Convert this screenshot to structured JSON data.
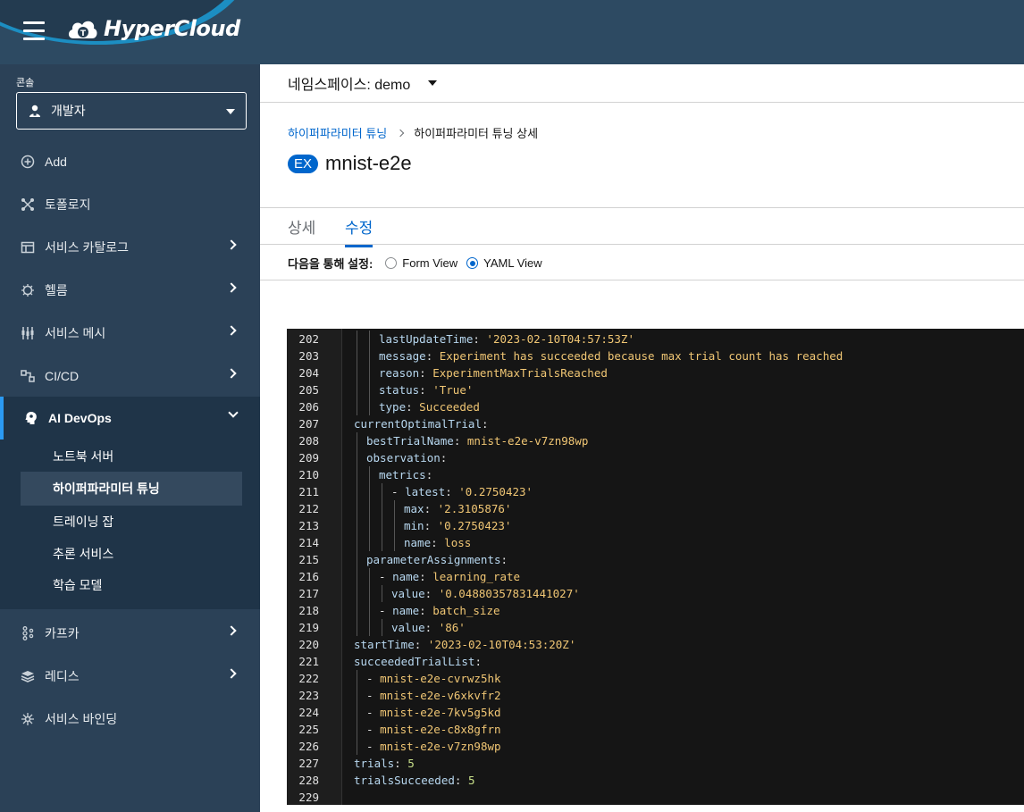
{
  "header": {
    "logo": "HyperCloud"
  },
  "sidebar": {
    "perspective_label": "콘솔",
    "perspective": "개발자",
    "items": [
      {
        "label": "Add",
        "icon": "add-circle-icon",
        "has_children": false
      },
      {
        "label": "토폴로지",
        "icon": "topology-icon",
        "has_children": false
      },
      {
        "label": "서비스 카탈로그",
        "icon": "catalog-icon",
        "has_children": true
      },
      {
        "label": "헬름",
        "icon": "helm-icon",
        "has_children": true
      },
      {
        "label": "서비스 메시",
        "icon": "mesh-icon",
        "has_children": true
      },
      {
        "label": "CI/CD",
        "icon": "cicd-icon",
        "has_children": true
      },
      {
        "label": "AI DevOps",
        "icon": "ai-brain-icon",
        "has_children": true,
        "expanded": true
      },
      {
        "label": "카프카",
        "icon": "kafka-icon",
        "has_children": true
      },
      {
        "label": "레디스",
        "icon": "redis-icon",
        "has_children": true
      },
      {
        "label": "서비스 바인딩",
        "icon": "binding-icon",
        "has_children": false
      }
    ],
    "sub_items": [
      {
        "label": "노트북 서버"
      },
      {
        "label": "하이퍼파라미터 튜닝",
        "selected": true
      },
      {
        "label": "트레이닝 잡"
      },
      {
        "label": "추론 서비스"
      },
      {
        "label": "학습 모델"
      }
    ]
  },
  "namespace": {
    "label": "네임스페이스: demo"
  },
  "breadcrumb": {
    "parent": "하이퍼파라미터 튜닝",
    "current": "하이퍼파라미터 튜닝 상세"
  },
  "page": {
    "badge": "EX",
    "title": "mnist-e2e"
  },
  "tabs": [
    {
      "label": "상세"
    },
    {
      "label": "수정",
      "active": true
    }
  ],
  "config": {
    "label": "다음을 통해 설정:",
    "options": [
      {
        "label": "Form View",
        "checked": false
      },
      {
        "label": "YAML View",
        "checked": true
      }
    ]
  },
  "editor": {
    "lines": [
      {
        "n": "202",
        "indent": 3,
        "tokens": [
          [
            "k",
            "lastUpdateTime"
          ],
          [
            "p",
            ": "
          ],
          [
            "s",
            "'2023-02-10T04:57:53Z'"
          ]
        ]
      },
      {
        "n": "203",
        "indent": 3,
        "tokens": [
          [
            "k",
            "message"
          ],
          [
            "p",
            ": "
          ],
          [
            "s",
            "Experiment has succeeded because max trial count has reached"
          ]
        ]
      },
      {
        "n": "204",
        "indent": 3,
        "tokens": [
          [
            "k",
            "reason"
          ],
          [
            "p",
            ": "
          ],
          [
            "s",
            "ExperimentMaxTrialsReached"
          ]
        ]
      },
      {
        "n": "205",
        "indent": 3,
        "tokens": [
          [
            "k",
            "status"
          ],
          [
            "p",
            ": "
          ],
          [
            "s",
            "'True'"
          ]
        ]
      },
      {
        "n": "206",
        "indent": 3,
        "tokens": [
          [
            "k",
            "type"
          ],
          [
            "p",
            ": "
          ],
          [
            "s",
            "Succeeded"
          ]
        ]
      },
      {
        "n": "207",
        "indent": 1,
        "tokens": [
          [
            "k",
            "currentOptimalTrial"
          ],
          [
            "p",
            ":"
          ]
        ]
      },
      {
        "n": "208",
        "indent": 2,
        "tokens": [
          [
            "k",
            "bestTrialName"
          ],
          [
            "p",
            ": "
          ],
          [
            "s",
            "mnist-e2e-v7zn98wp"
          ]
        ]
      },
      {
        "n": "209",
        "indent": 2,
        "tokens": [
          [
            "k",
            "observation"
          ],
          [
            "p",
            ":"
          ]
        ]
      },
      {
        "n": "210",
        "indent": 3,
        "tokens": [
          [
            "k",
            "metrics"
          ],
          [
            "p",
            ":"
          ]
        ]
      },
      {
        "n": "211",
        "indent": 4,
        "tokens": [
          [
            "p",
            "- "
          ],
          [
            "k",
            "latest"
          ],
          [
            "p",
            ": "
          ],
          [
            "s",
            "'0.2750423'"
          ]
        ]
      },
      {
        "n": "212",
        "indent": 5,
        "tokens": [
          [
            "k",
            "max"
          ],
          [
            "p",
            ": "
          ],
          [
            "s",
            "'2.3105876'"
          ]
        ]
      },
      {
        "n": "213",
        "indent": 5,
        "tokens": [
          [
            "k",
            "min"
          ],
          [
            "p",
            ": "
          ],
          [
            "s",
            "'0.2750423'"
          ]
        ]
      },
      {
        "n": "214",
        "indent": 5,
        "tokens": [
          [
            "k",
            "name"
          ],
          [
            "p",
            ": "
          ],
          [
            "s",
            "loss"
          ]
        ]
      },
      {
        "n": "215",
        "indent": 2,
        "tokens": [
          [
            "k",
            "parameterAssignments"
          ],
          [
            "p",
            ":"
          ]
        ]
      },
      {
        "n": "216",
        "indent": 3,
        "tokens": [
          [
            "p",
            "- "
          ],
          [
            "k",
            "name"
          ],
          [
            "p",
            ": "
          ],
          [
            "s",
            "learning_rate"
          ]
        ]
      },
      {
        "n": "217",
        "indent": 4,
        "tokens": [
          [
            "k",
            "value"
          ],
          [
            "p",
            ": "
          ],
          [
            "s",
            "'0.04880357831441027'"
          ]
        ]
      },
      {
        "n": "218",
        "indent": 3,
        "tokens": [
          [
            "p",
            "- "
          ],
          [
            "k",
            "name"
          ],
          [
            "p",
            ": "
          ],
          [
            "s",
            "batch_size"
          ]
        ]
      },
      {
        "n": "219",
        "indent": 4,
        "tokens": [
          [
            "k",
            "value"
          ],
          [
            "p",
            ": "
          ],
          [
            "s",
            "'86'"
          ]
        ]
      },
      {
        "n": "220",
        "indent": 1,
        "tokens": [
          [
            "k",
            "startTime"
          ],
          [
            "p",
            ": "
          ],
          [
            "s",
            "'2023-02-10T04:53:20Z'"
          ]
        ]
      },
      {
        "n": "221",
        "indent": 1,
        "tokens": [
          [
            "k",
            "succeededTrialList"
          ],
          [
            "p",
            ":"
          ]
        ]
      },
      {
        "n": "222",
        "indent": 2,
        "tokens": [
          [
            "p",
            "- "
          ],
          [
            "s",
            "mnist-e2e-cvrwz5hk"
          ]
        ]
      },
      {
        "n": "223",
        "indent": 2,
        "tokens": [
          [
            "p",
            "- "
          ],
          [
            "s",
            "mnist-e2e-v6xkvfr2"
          ]
        ]
      },
      {
        "n": "224",
        "indent": 2,
        "tokens": [
          [
            "p",
            "- "
          ],
          [
            "s",
            "mnist-e2e-7kv5g5kd"
          ]
        ]
      },
      {
        "n": "225",
        "indent": 2,
        "tokens": [
          [
            "p",
            "- "
          ],
          [
            "s",
            "mnist-e2e-c8x8gfrn"
          ]
        ]
      },
      {
        "n": "226",
        "indent": 2,
        "tokens": [
          [
            "p",
            "- "
          ],
          [
            "s",
            "mnist-e2e-v7zn98wp"
          ]
        ]
      },
      {
        "n": "227",
        "indent": 1,
        "tokens": [
          [
            "k",
            "trials"
          ],
          [
            "p",
            ": "
          ],
          [
            "n",
            "5"
          ]
        ]
      },
      {
        "n": "228",
        "indent": 1,
        "tokens": [
          [
            "k",
            "trialsSucceeded"
          ],
          [
            "p",
            ": "
          ],
          [
            "n",
            "5"
          ]
        ]
      },
      {
        "n": "229",
        "indent": 0,
        "tokens": []
      }
    ]
  }
}
